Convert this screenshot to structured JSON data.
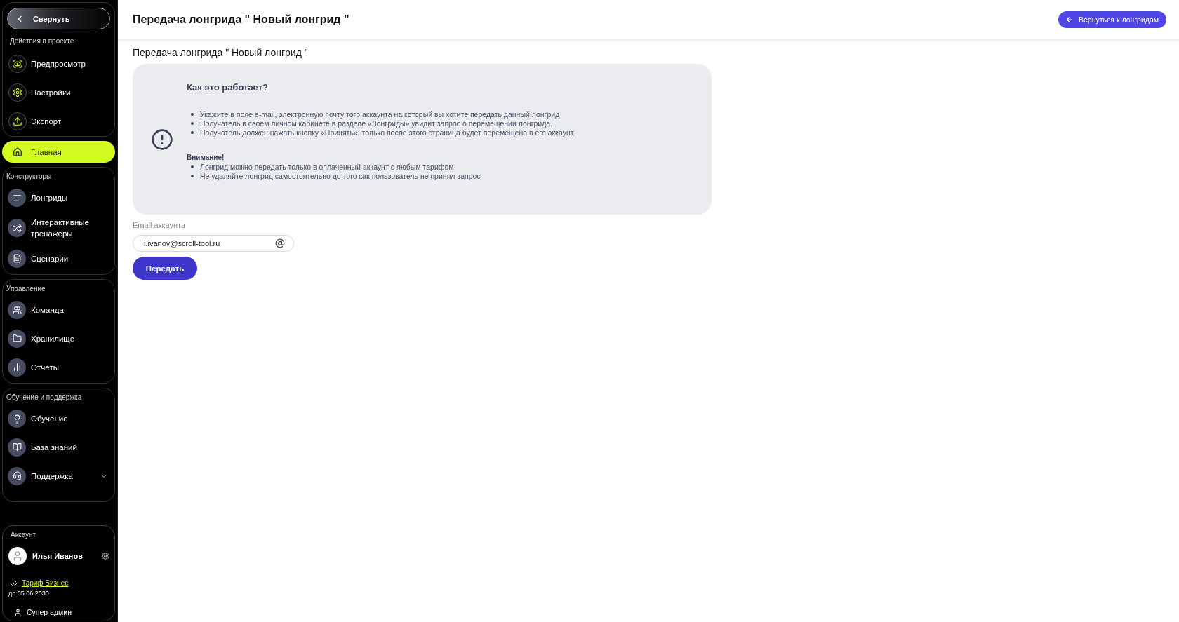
{
  "sidebar": {
    "collapse_button": "Свернуть",
    "project_actions": {
      "title": "Действия в проекте",
      "items": [
        "Предпросмотр",
        "Настройки",
        "Экспорт"
      ]
    },
    "home": {
      "label": "Главная",
      "selected": true
    },
    "sections": [
      {
        "title": "Конструкторы",
        "items": [
          {
            "label": "Лонгриды",
            "selected": false
          },
          {
            "label": "Интерактивные тренажёры",
            "selected": false
          },
          {
            "label": "Сценарии",
            "selected": false
          }
        ]
      },
      {
        "title": "Управление",
        "items": [
          {
            "label": "Команда",
            "selected": false
          },
          {
            "label": "Хранилище",
            "selected": false
          },
          {
            "label": "Отчёты",
            "selected": false
          }
        ]
      },
      {
        "title": "Обучение и поддержка",
        "items": [
          {
            "label": "Обучение",
            "selected": false
          },
          {
            "label": "База знаний",
            "selected": false
          },
          {
            "label": "Поддержка",
            "selected": false,
            "expanded": false
          }
        ]
      }
    ],
    "account": {
      "title": "Аккаунт",
      "name": "Илья Иванов",
      "plan": "Тариф Бизнес",
      "plan_until": "до 05.06.2030",
      "role": "Супер админ"
    }
  },
  "header": {
    "title": "Передача лонгрида \" Новый лонгрид \"",
    "back_button": "Вернуться к лонгридам"
  },
  "content": {
    "subtitle": "Передача лонгрида \" Новый лонгрид \"",
    "info": {
      "heading": "Как это работает?",
      "steps": [
        "Укажите в поле e-mail, электронную почту того аккаунта на который вы хотите передать данный лонгрид",
        "Получатель в своем личном кабинете в разделе «Лонгриды» увидит запрос о перемещении лонгрида.",
        "Получатель должен нажать кнопку «Принять», только после этого страница будет перемещена в его аккаунт."
      ],
      "warning_title": "Внимание!",
      "warnings": [
        "Лонгрид можно передать только в оплаченный аккаунт с любым тарифом",
        "Не удаляйте лонгрид самостоятельно до того как пользователь не принял запрос"
      ]
    },
    "email": {
      "label": "Email аккаунта",
      "value": "i.ivanov@scroll-tool.ru"
    },
    "submit_button": "Передать"
  }
}
